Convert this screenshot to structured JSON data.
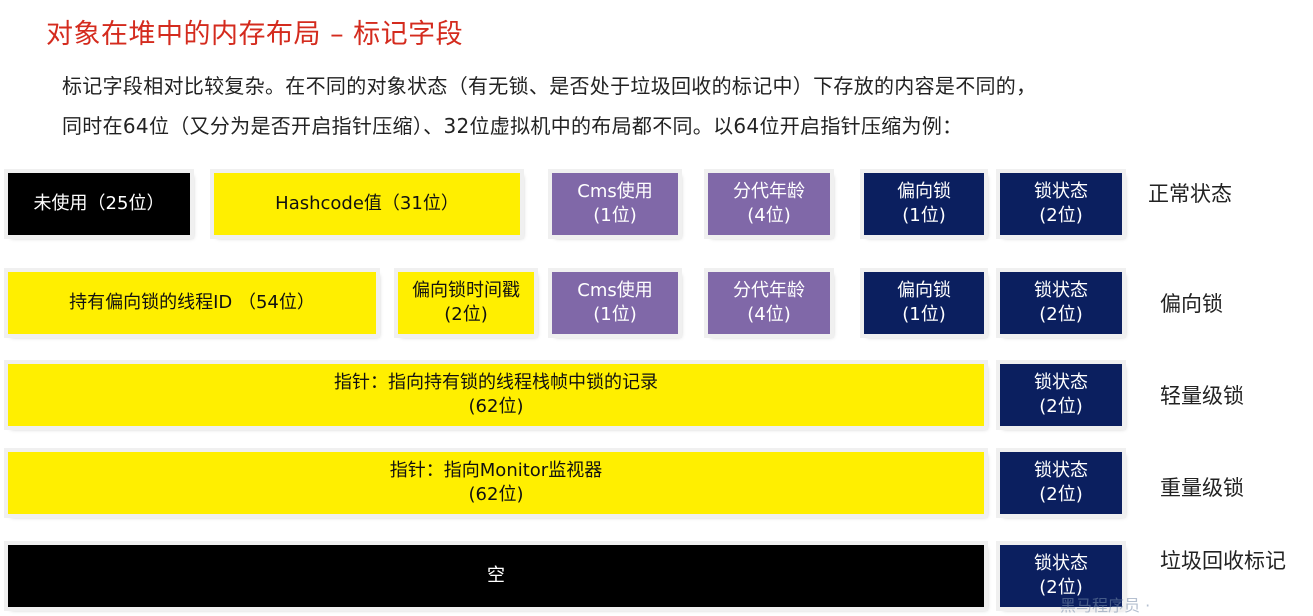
{
  "title": "对象在堆中的内存布局 – 标记字段",
  "description": {
    "line1": "标记字段相对比较复杂。在不同的对象状态（有无锁、是否处于垃圾回收的标记中）下存放的内容是不同的，",
    "line2": "同时在64位（又分为是否开启指针压缩）、32位虚拟机中的布局都不同。以64位开启指针压缩为例："
  },
  "rows": [
    {
      "state": "正常状态",
      "cells": [
        {
          "label": "未使用（25位）",
          "color": "black"
        },
        {
          "label": "Hashcode值（31位）",
          "color": "yellow"
        },
        {
          "label": "Cms使用\n(1位)",
          "color": "purple"
        },
        {
          "label": "分代年龄\n(4位)",
          "color": "purple"
        },
        {
          "label": "偏向锁\n(1位)",
          "color": "navy"
        },
        {
          "label": "锁状态\n(2位)",
          "color": "navy"
        }
      ]
    },
    {
      "state": "偏向锁",
      "cells": [
        {
          "label": "持有偏向锁的线程ID  （54位）",
          "color": "yellow"
        },
        {
          "label": "偏向锁时间戳\n(2位)",
          "color": "yellow"
        },
        {
          "label": "Cms使用\n(1位)",
          "color": "purple"
        },
        {
          "label": "分代年龄\n(4位)",
          "color": "purple"
        },
        {
          "label": "偏向锁\n(1位)",
          "color": "navy"
        },
        {
          "label": "锁状态\n(2位)",
          "color": "navy"
        }
      ]
    },
    {
      "state": "轻量级锁",
      "cells": [
        {
          "label": "指针：指向持有锁的线程栈帧中锁的记录\n(62位)",
          "color": "yellow"
        },
        {
          "label": "锁状态\n(2位)",
          "color": "navy"
        }
      ]
    },
    {
      "state": "重量级锁",
      "cells": [
        {
          "label": "指针：指向Monitor监视器\n(62位)",
          "color": "yellow"
        },
        {
          "label": "锁状态\n(2位)",
          "color": "navy"
        }
      ]
    },
    {
      "state": "垃圾回收标记",
      "cells": [
        {
          "label": "空",
          "color": "black"
        },
        {
          "label": "锁状态\n(2位)",
          "color": "navy"
        }
      ]
    }
  ],
  "colors": {
    "black": "#000000",
    "yellow": "#ffef00",
    "purple": "#8068a8",
    "navy": "#0b1f5f",
    "title": "#d42b1e"
  },
  "watermark": "黑马程序员 ·"
}
